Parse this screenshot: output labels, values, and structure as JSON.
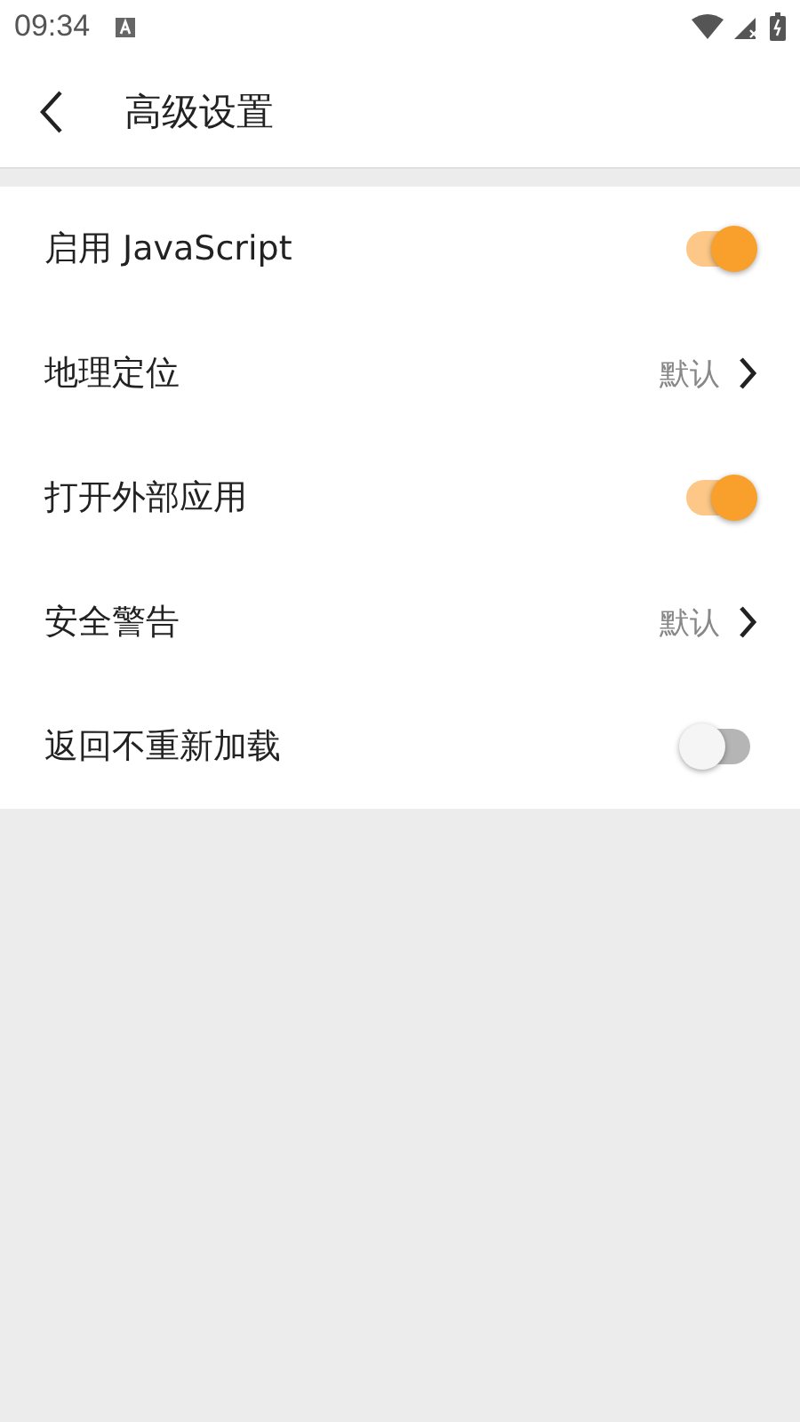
{
  "status_bar": {
    "time": "09:34"
  },
  "app_bar": {
    "title": "高级设置"
  },
  "settings": [
    {
      "kind": "toggle",
      "label": "启用 JavaScript",
      "on": true
    },
    {
      "kind": "link",
      "label": "地理定位",
      "value": "默认"
    },
    {
      "kind": "toggle",
      "label": "打开外部应用",
      "on": true
    },
    {
      "kind": "link",
      "label": "安全警告",
      "value": "默认"
    },
    {
      "kind": "toggle",
      "label": "返回不重新加载",
      "on": false
    }
  ]
}
